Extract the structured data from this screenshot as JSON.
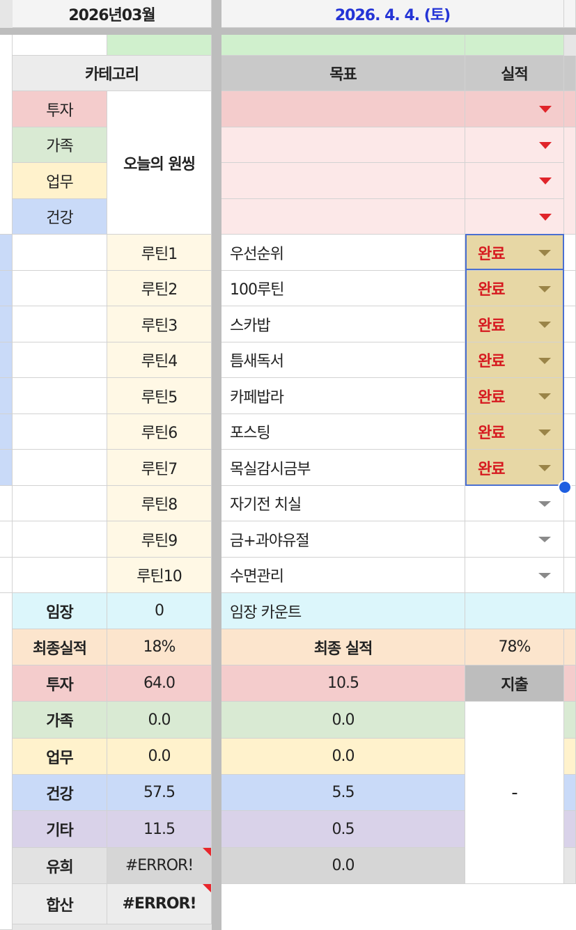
{
  "header": {
    "month": "2026년03월",
    "date": "2026. 4. 4. (토)"
  },
  "table": {
    "col_category": "카테고리",
    "col_goal": "목표",
    "col_result": "실적"
  },
  "one_thing": {
    "label": "오늘의 원씽",
    "categories": [
      "투자",
      "가족",
      "업무",
      "건강"
    ]
  },
  "routines": [
    {
      "label": "루틴1",
      "goal": "우선순위",
      "status": "완료"
    },
    {
      "label": "루틴2",
      "goal": "100루틴",
      "status": "완료"
    },
    {
      "label": "루틴3",
      "goal": "스카밥",
      "status": "완료"
    },
    {
      "label": "루틴4",
      "goal": "틈새독서",
      "status": "완료"
    },
    {
      "label": "루틴5",
      "goal": "카페밥라",
      "status": "완료"
    },
    {
      "label": "루틴6",
      "goal": "포스팅",
      "status": "완료"
    },
    {
      "label": "루틴7",
      "goal": "목실감시금부",
      "status": "완료"
    },
    {
      "label": "루틴8",
      "goal": "자기전 치실",
      "status": ""
    },
    {
      "label": "루틴9",
      "goal": "금+과야유절",
      "status": ""
    },
    {
      "label": "루틴10",
      "goal": "수면관리",
      "status": ""
    }
  ],
  "imjang": {
    "label": "임장",
    "value": "0",
    "note": "임장 카운트"
  },
  "final": {
    "label": "최종실적",
    "value": "18%",
    "label2": "최종 실적",
    "value2": "78%"
  },
  "spend": {
    "header": "지출",
    "merged_value": "-",
    "rows": [
      {
        "label": "투자",
        "v1": "64.0",
        "v2": "10.5"
      },
      {
        "label": "가족",
        "v1": "0.0",
        "v2": "0.0"
      },
      {
        "label": "업무",
        "v1": "0.0",
        "v2": "0.0"
      },
      {
        "label": "건강",
        "v1": "57.5",
        "v2": "5.5"
      },
      {
        "label": "기타",
        "v1": "11.5",
        "v2": "0.5"
      },
      {
        "label": "유희",
        "v1": "#ERROR!",
        "v2": "0.0"
      }
    ]
  },
  "sum": {
    "label": "합산",
    "value": "#ERROR!"
  },
  "colors": {
    "pink": "#f4cccc",
    "light_pink": "#fce8e8",
    "green": "#d9ead3",
    "yellow": "#fff2cc",
    "blue": "#c9daf8",
    "purple": "#d9d2e9",
    "peach": "#fce5cd",
    "cyan": "#dcf6fb",
    "cream": "#fff8e5",
    "header_gray": "#ececec",
    "dark_gray": "#c9c9c9",
    "mint": "#d0f0cd",
    "gold": "#e7d7a5",
    "date_blue": "#2434d6"
  }
}
